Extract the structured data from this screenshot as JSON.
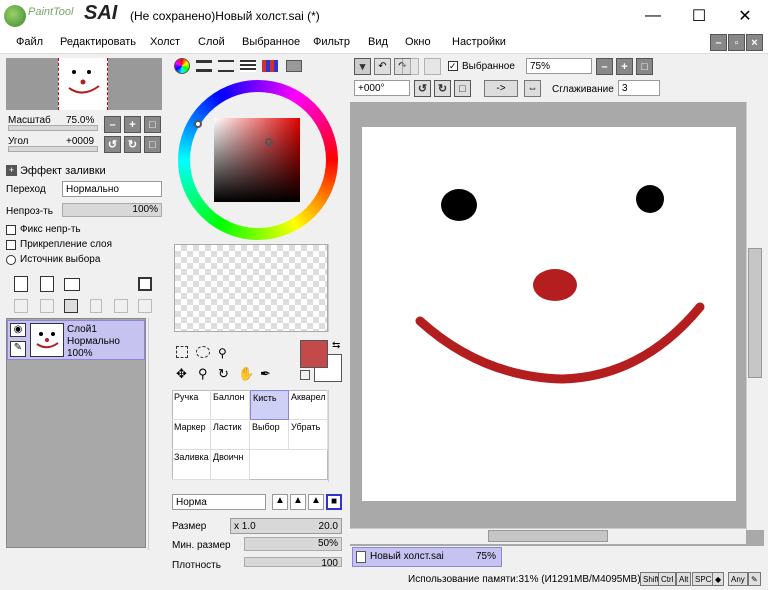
{
  "window": {
    "logo_text": "PaintTool",
    "logo_sai": "SAI",
    "title": "(Не сохранено)Новый холст.sai (*)"
  },
  "menu": [
    "Файл",
    "Редактировать",
    "Холст",
    "Слой",
    "Выбранное",
    "Фильтр",
    "Вид",
    "Окно",
    "Настройки"
  ],
  "navigator": {
    "scale_label": "Масштаб",
    "scale_value": "75.0%",
    "angle_label": "Угол",
    "angle_value": "+0009"
  },
  "layer_panel": {
    "fill_effect_label": "Эффект заливки",
    "blend_label": "Переход",
    "blend_value": "Нормально",
    "opacity_label": "Непроз-ть",
    "opacity_value": "100%",
    "fix_opacity": "Фикс непр-ть",
    "clip_layer": "Прикрепление слоя",
    "selection_source": "Источник выбора",
    "layer_name": "Слой1",
    "layer_mode": "Нормально",
    "layer_opacity": "100%"
  },
  "tools": [
    [
      "Ручка",
      "Баллон",
      "Кисть",
      "Акварел"
    ],
    [
      "Маркер",
      "Ластик",
      "Выбор",
      "Убрать"
    ],
    [
      "Заливка",
      "Двоичн",
      "",
      ""
    ]
  ],
  "brush": {
    "mode": "Норма",
    "size_label": "Размер",
    "size_mult": "x 1.0",
    "size_value": "20.0",
    "min_size_label": "Мин. размер",
    "min_size_value": "50%",
    "density_label": "Плотность",
    "density_value": "100"
  },
  "canvas_toolbar": {
    "selection_label": "Выбранное",
    "zoom_value": "75%",
    "angle_value": "+000°",
    "arrow_button": "->",
    "smoothing_label": "Сглаживание",
    "smoothing_value": "3"
  },
  "canvas_tab": {
    "name": "Новый холст.sai",
    "zoom": "75%"
  },
  "status": {
    "memory": "Использование памяти:31% (И1291MB/M4095MB)",
    "keys": [
      "Shift",
      "Ctrl",
      "Alt",
      "SPC",
      "◆",
      "Any"
    ]
  },
  "colors": {
    "accent": "#c7c3f0",
    "primary_color": "#c24a4a",
    "stroke_red": "#b51e1e"
  }
}
